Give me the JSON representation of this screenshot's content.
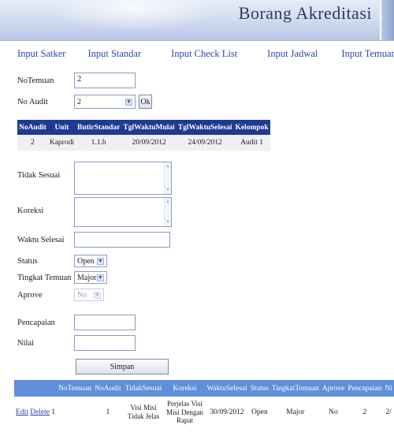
{
  "header": {
    "title": "Borang Akreditasi"
  },
  "nav": [
    {
      "label": "Input Satker"
    },
    {
      "label": "Input Standar"
    },
    {
      "label": "Input Check List"
    },
    {
      "label": "Input Jadwal"
    },
    {
      "label": "Input Temuan"
    }
  ],
  "form": {
    "no_temuan": {
      "label": "NoTemuan",
      "value": "2"
    },
    "no_audit": {
      "label": "No Audit",
      "value": "2",
      "button": "Ok"
    },
    "tidak_sesuai": {
      "label": "Tidak Sesuai",
      "value": ""
    },
    "koreksi": {
      "label": "Koreksi",
      "value": ""
    },
    "waktu_selesai": {
      "label": "Waktu Selesai",
      "value": ""
    },
    "status": {
      "label": "Status",
      "value": "Open"
    },
    "tingkat_temuan": {
      "label": "Tingkat Temuan",
      "value": "Major"
    },
    "aprove": {
      "label": "Aprove",
      "value": "No"
    },
    "pencapaian": {
      "label": "Pencapaian",
      "value": ""
    },
    "nilai": {
      "label": "Nilai",
      "value": ""
    },
    "submit_label": "Simpan"
  },
  "audit_table": {
    "headers": [
      "NoAudit",
      "Unit",
      "ButirStandar",
      "TglWaktuMulai",
      "TglWaktuSelesai",
      "Kelompok"
    ],
    "rows": [
      [
        "2",
        "Kaprodi",
        "1.1.b",
        "20/09/2012",
        "24/09/2012",
        "Audit 1"
      ]
    ]
  },
  "temuan_table": {
    "headers": [
      "",
      "NoTemuan",
      "NoAudit",
      "TidakSesuai",
      "Koreksi",
      "WaktuSelesai",
      "Status",
      "TingkatTemuan",
      "Aprove",
      "Pencapaian",
      "Ni"
    ],
    "rows": [
      {
        "edit": "Edit",
        "delete": "Delete",
        "no_temuan": "1",
        "no_audit": "1",
        "tidak_sesuai": "Visi Misi Tidak Jelas",
        "koreksi": "Perjelas Visi Misi Dengan Rapat",
        "waktu_selesai": "30/09/2012",
        "status": "Open",
        "tingkat": "Major",
        "aprove": "No",
        "pencapaian": "2",
        "nilai": "2/"
      }
    ]
  },
  "colors": {
    "table_header_dark": "#1f3a93",
    "table_header_light": "#5f8fd9",
    "nav_link": "#2b47a8"
  }
}
